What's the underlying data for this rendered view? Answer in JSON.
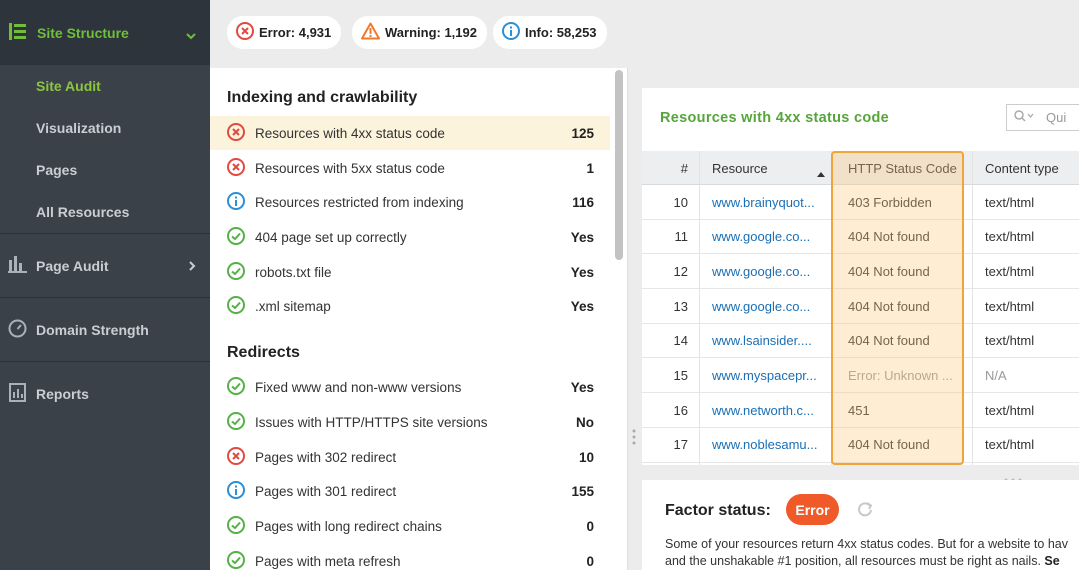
{
  "sidebar": {
    "section": "Site Structure",
    "sub_items": [
      "Site Audit",
      "Visualization",
      "Pages",
      "All Resources"
    ],
    "items": [
      "Page Audit",
      "Domain Strength",
      "Reports"
    ]
  },
  "badges": {
    "error": "Error: 4,931",
    "warning": "Warning: 1,192",
    "info": "Info: 58,253"
  },
  "left_panel": {
    "sections": [
      {
        "title": "Indexing and crawlability",
        "rows": [
          {
            "status": "error",
            "label": "Resources with 4xx status code",
            "value": "125"
          },
          {
            "status": "error",
            "label": "Resources with 5xx status code",
            "value": "1"
          },
          {
            "status": "info",
            "label": "Resources restricted from indexing",
            "value": "116"
          },
          {
            "status": "ok",
            "label": "404 page set up correctly",
            "value": "Yes"
          },
          {
            "status": "ok",
            "label": "robots.txt file",
            "value": "Yes"
          },
          {
            "status": "ok",
            "label": ".xml sitemap",
            "value": "Yes"
          }
        ]
      },
      {
        "title": "Redirects",
        "rows": [
          {
            "status": "ok",
            "label": "Fixed www and non-www versions",
            "value": "Yes"
          },
          {
            "status": "ok",
            "label": "Issues with HTTP/HTTPS site versions",
            "value": "No"
          },
          {
            "status": "error",
            "label": "Pages with 302 redirect",
            "value": "10"
          },
          {
            "status": "info",
            "label": "Pages with 301 redirect",
            "value": "155"
          },
          {
            "status": "ok",
            "label": "Pages with long redirect chains",
            "value": "0"
          },
          {
            "status": "ok",
            "label": "Pages with meta refresh",
            "value": "0"
          }
        ]
      }
    ]
  },
  "table": {
    "title": "Resources with 4xx status code",
    "search_placeholder": "Qui",
    "columns": [
      "#",
      "Resource",
      "HTTP Status Code",
      "Content type"
    ],
    "rows": [
      {
        "n": "10",
        "resource": "www.brainyquot...",
        "code": "403 Forbidden",
        "ctype": "text/html",
        "muted": false
      },
      {
        "n": "11",
        "resource": "www.google.co...",
        "code": "404 Not found",
        "ctype": "text/html",
        "muted": false
      },
      {
        "n": "12",
        "resource": "www.google.co...",
        "code": "404 Not found",
        "ctype": "text/html",
        "muted": false
      },
      {
        "n": "13",
        "resource": "www.google.co...",
        "code": "404 Not found",
        "ctype": "text/html",
        "muted": false
      },
      {
        "n": "14",
        "resource": "www.lsainsider....",
        "code": "404 Not found",
        "ctype": "text/html",
        "muted": false
      },
      {
        "n": "15",
        "resource": "www.myspacepr...",
        "code": "Error: Unknown ...",
        "ctype": "N/A",
        "muted": true
      },
      {
        "n": "16",
        "resource": "www.networth.c...",
        "code": "451",
        "ctype": "text/html",
        "muted": false
      },
      {
        "n": "17",
        "resource": "www.noblesamu...",
        "code": "404 Not found",
        "ctype": "text/html",
        "muted": false
      }
    ]
  },
  "factor": {
    "title": "Factor status:",
    "status": "Error",
    "line1": "Some of your resources return 4xx status codes. But for a website to hav",
    "line2_plain": "and the unshakable #1 position, all resources must be right as nails. ",
    "line2_bold": "Se"
  },
  "colors": {
    "accent_green": "#56a53b",
    "error_red": "#e04a3f",
    "info_blue": "#2b8fd8",
    "ok_green": "#55b047",
    "highlight_orange": "#f0a43a"
  }
}
